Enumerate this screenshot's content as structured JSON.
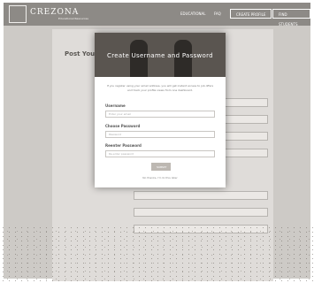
{
  "header": {
    "logo_text": "CREZONA",
    "logo_sub": "Educational Resources",
    "nav_items": [
      "EDUCATIONAL",
      "FAQ"
    ],
    "nav_buttons": [
      "CREATE PROFILE",
      "FIND STUDENTS"
    ]
  },
  "page": {
    "title": "Post Your P"
  },
  "modal": {
    "title": "Create Username and Password",
    "intro": "If you register using your email address, you will get instant access to job offers and track your profile views from one dashboard.",
    "fields": [
      {
        "label": "Username",
        "placeholder": "Enter your email"
      },
      {
        "label": "Choose Password",
        "placeholder": "Password"
      },
      {
        "label": "Reenter Password",
        "placeholder": "Re-enter password"
      }
    ],
    "submit_label": "SUBMIT",
    "cancel_label": "No thanks, I'll do this later"
  }
}
